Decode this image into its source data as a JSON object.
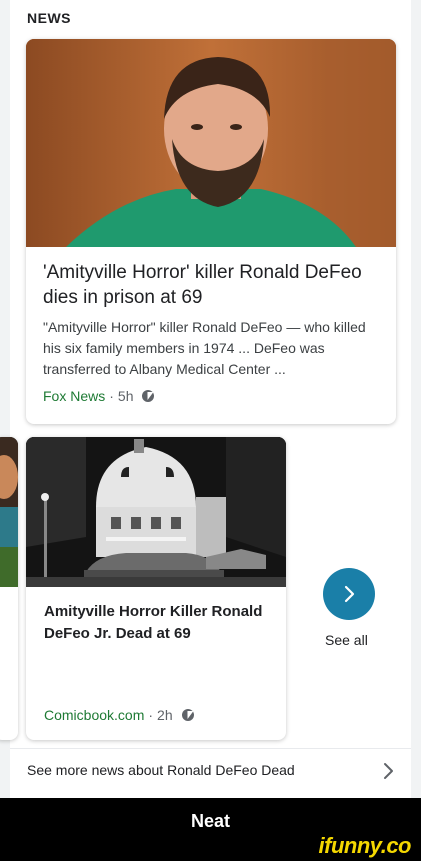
{
  "section": {
    "heading": "NEWS"
  },
  "card1": {
    "title": "'Amityville Horror' killer Ronald DeFeo dies in prison at 69",
    "snippet": "\"Amityville Horror\" killer Ronald DeFeo — who killed his six family members in 1974 ... DeFeo was transferred to Albany Medical Center ...",
    "source": "Fox News",
    "separator": "·",
    "time": "5h",
    "amp_icon": "amp-icon"
  },
  "card2": {
    "title": "Amityville Horror Killer Ronald DeFeo Jr. Dead at 69",
    "source": "Comicbook.com",
    "separator": "·",
    "time": "2h",
    "amp_icon": "amp-icon"
  },
  "see_all": {
    "label": "See all",
    "icon": "chevron-right-icon"
  },
  "more_news": {
    "label": "See more news about Ronald DeFeo Dead",
    "icon": "chevron-right-icon"
  },
  "caption": {
    "text": "Neat"
  },
  "watermark": {
    "text": "ifunny.co"
  },
  "colors": {
    "source_green": "#1e7a34",
    "see_all_button": "#1a7fa8",
    "watermark": "#f5d800"
  }
}
